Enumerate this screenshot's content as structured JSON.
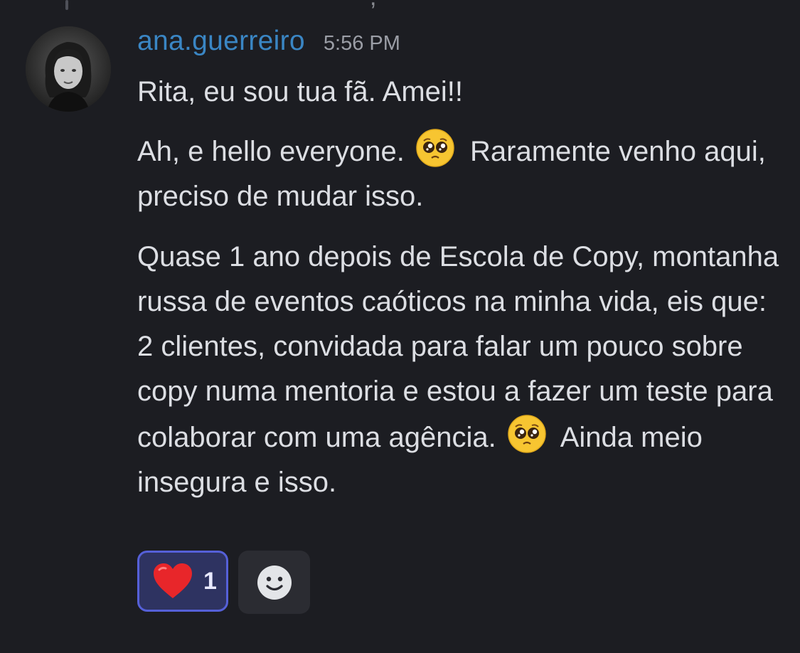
{
  "message": {
    "author": "ana.guerreiro",
    "timestamp": "5:56 PM",
    "paragraphs": [
      "Rita, eu sou tua fã. Amei!!",
      {
        "before": "Ah, e hello everyone. ",
        "after": " Raramente venho aqui, preciso de mudar isso."
      },
      {
        "before": "Quase 1 ano depois de Escola de Copy, montanha russa de eventos caóticos na minha vida, eis que: 2 clientes, convidada para falar um pouco sobre copy numa mentoria e estou a fazer um teste para colaborar com uma agência. ",
        "after": " Ainda meio insegura e isso."
      }
    ],
    "inline_emoji": "pleading-face-emoji"
  },
  "reactions": [
    {
      "icon": "red-heart-emoji",
      "count": "1",
      "selected": true
    }
  ],
  "add_reaction": {
    "icon": "smiley-add-reaction-icon"
  },
  "colors": {
    "background": "#1c1d22",
    "username": "#3a86c4",
    "text": "#dcdee3",
    "timestamp": "#9b9ea6",
    "reaction_bg": "#2e3361",
    "reaction_border": "#5560d8",
    "add_reaction_bg": "#2b2c32"
  }
}
